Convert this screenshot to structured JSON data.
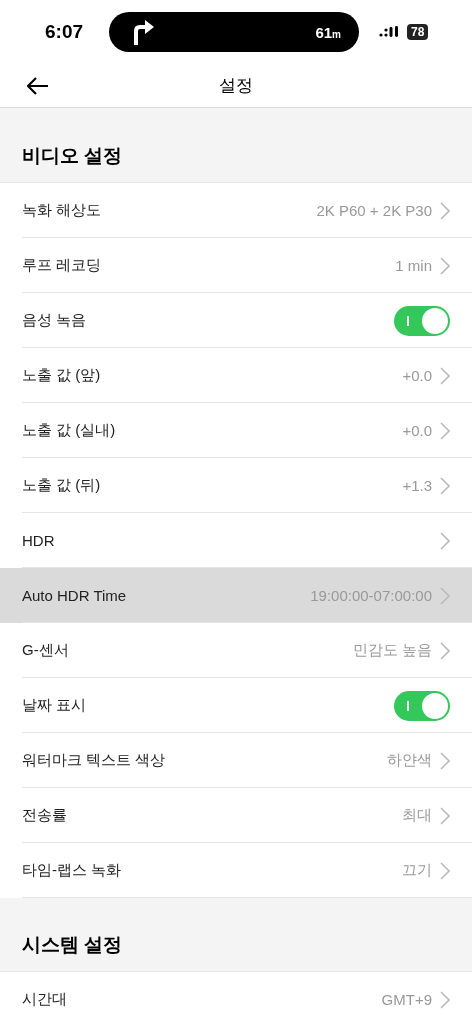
{
  "status_bar": {
    "time": "6:07",
    "distance": "61",
    "distance_unit": "m",
    "battery": "78"
  },
  "header": {
    "title": "설정"
  },
  "sections": [
    {
      "title": "비디오 설정",
      "rows": [
        {
          "kind": "value",
          "label": "녹화 해상도",
          "value": "2K P60 + 2K P30",
          "selected": false
        },
        {
          "kind": "value",
          "label": "루프 레코딩",
          "value": "1 min",
          "selected": false
        },
        {
          "kind": "toggle",
          "label": "음성 녹음",
          "on": true,
          "selected": false
        },
        {
          "kind": "value",
          "label": "노출 값 (앞)",
          "value": "+0.0",
          "selected": false
        },
        {
          "kind": "value",
          "label": "노출 값 (실내)",
          "value": "+0.0",
          "selected": false
        },
        {
          "kind": "value",
          "label": "노출 값 (뒤)",
          "value": "+1.3",
          "selected": false
        },
        {
          "kind": "value",
          "label": "HDR",
          "selected": false
        },
        {
          "kind": "value",
          "label": "Auto HDR Time",
          "value": "19:00:00-07:00:00",
          "selected": true
        },
        {
          "kind": "value",
          "label": "G-센서",
          "value": "민감도 높음",
          "selected": false
        },
        {
          "kind": "toggle",
          "label": "날짜 표시",
          "on": true,
          "selected": false
        },
        {
          "kind": "value",
          "label": "워터마크 텍스트 색상",
          "value": "하얀색",
          "selected": false
        },
        {
          "kind": "value",
          "label": "전송률",
          "value": "최대",
          "selected": false
        },
        {
          "kind": "value",
          "label": "타임-랩스 녹화",
          "value": "끄기",
          "selected": false
        }
      ]
    },
    {
      "title": "시스템 설정",
      "rows": [
        {
          "kind": "value",
          "label": "시간대",
          "value": "GMT+9",
          "selected": false
        }
      ]
    }
  ]
}
